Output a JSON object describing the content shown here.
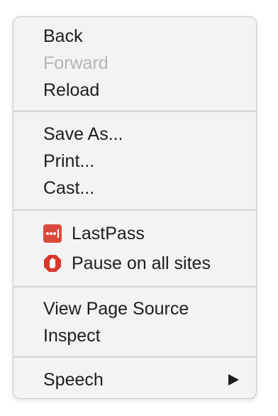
{
  "menu": {
    "groups": [
      {
        "items": [
          {
            "label": "Back"
          },
          {
            "label": "Forward",
            "disabled": true
          },
          {
            "label": "Reload"
          }
        ]
      },
      {
        "items": [
          {
            "label": "Save As..."
          },
          {
            "label": "Print..."
          },
          {
            "label": "Cast..."
          }
        ]
      },
      {
        "items": [
          {
            "label": "LastPass",
            "icon": "lastpass-icon"
          },
          {
            "label": "Pause on all sites",
            "icon": "adblock-stop-hand-icon"
          }
        ]
      },
      {
        "items": [
          {
            "label": "View Page Source"
          },
          {
            "label": "Inspect"
          }
        ]
      },
      {
        "items": [
          {
            "label": "Speech",
            "submenu": true
          }
        ]
      }
    ]
  },
  "colors": {
    "menu_background": "#f3f3f3",
    "text": "#1d1d1d",
    "disabled_text": "#b5b5b5",
    "separator": "#d8d8d8",
    "lastpass_red": "#d84b3c",
    "adblock_red": "#d8392b"
  }
}
